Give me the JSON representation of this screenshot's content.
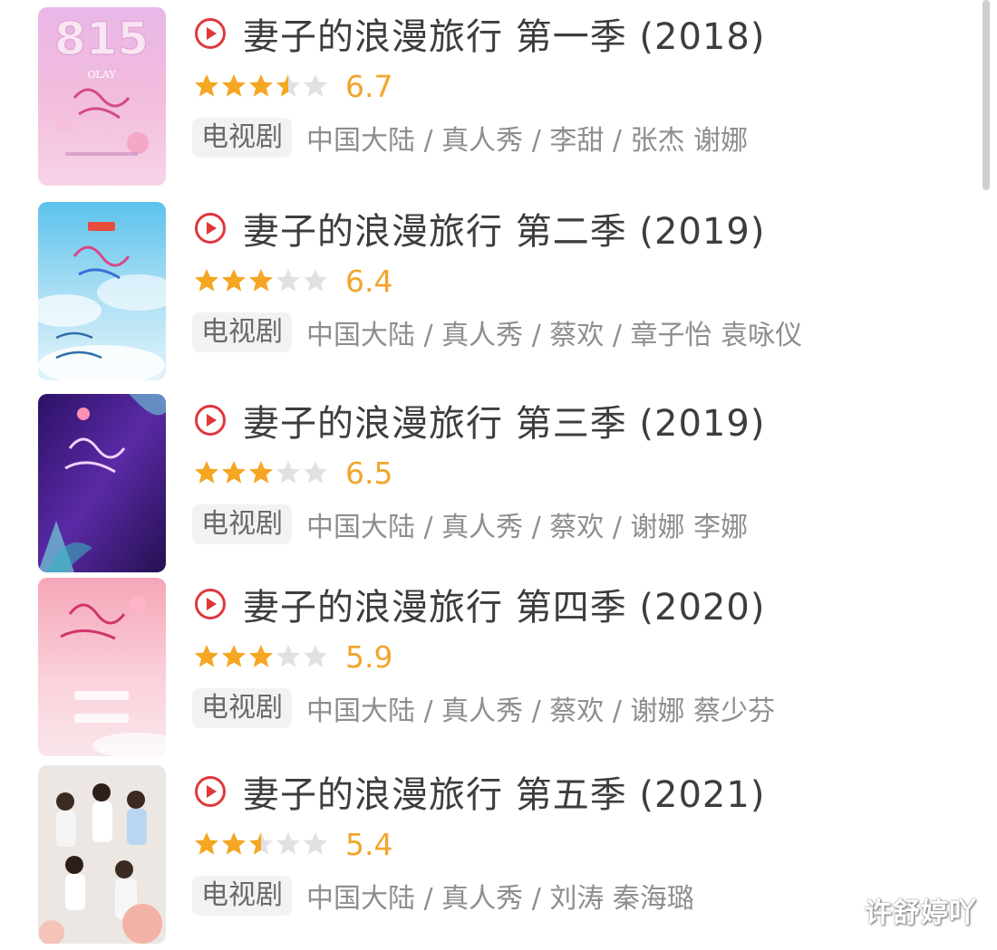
{
  "items": [
    {
      "title": "妻子的浪漫旅行 第一季 (2018)",
      "stars": 3.5,
      "score": "6.7",
      "tag": "电视剧",
      "meta": "中国大陆 / 真人秀 / 李甜 / 张杰 谢娜",
      "poster_icon": "poster-season-1",
      "poster_colors": [
        "#f5b8d8",
        "#d9a5e6",
        "#f8cfe5"
      ]
    },
    {
      "title": "妻子的浪漫旅行 第二季 (2019)",
      "stars": 3,
      "score": "6.4",
      "tag": "电视剧",
      "meta": "中国大陆 / 真人秀 / 蔡欢 / 章子怡 袁咏仪",
      "poster_icon": "poster-season-2",
      "poster_colors": [
        "#8fd3f0",
        "#bfe7f8",
        "#e8f6fc"
      ]
    },
    {
      "title": "妻子的浪漫旅行 第三季 (2019)",
      "stars": 3,
      "score": "6.5",
      "tag": "电视剧",
      "meta": "中国大陆 / 真人秀 / 蔡欢 / 谢娜 李娜",
      "poster_icon": "poster-season-3",
      "poster_colors": [
        "#3a1a7a",
        "#5a2aa0",
        "#2a1060"
      ]
    },
    {
      "title": "妻子的浪漫旅行 第四季 (2020)",
      "stars": 3,
      "score": "5.9",
      "tag": "电视剧",
      "meta": "中国大陆 / 真人秀 / 蔡欢 / 谢娜 蔡少芬",
      "poster_icon": "poster-season-4",
      "poster_colors": [
        "#f7b6c4",
        "#fbd4dc",
        "#f9e4e8"
      ]
    },
    {
      "title": "妻子的浪漫旅行 第五季 (2021)",
      "stars": 2.5,
      "score": "5.4",
      "tag": "电视剧",
      "meta": "中国大陆 / 真人秀 / 刘涛 秦海璐",
      "poster_icon": "poster-season-5",
      "poster_colors": [
        "#ececec",
        "#f6d2c8",
        "#f3b9b0"
      ]
    }
  ],
  "watermark": "许舒婷吖",
  "colors": {
    "play": "#e0383b",
    "star_on": "#f5a623",
    "star_off": "#e1e1e1",
    "score": "#f2a52b"
  }
}
